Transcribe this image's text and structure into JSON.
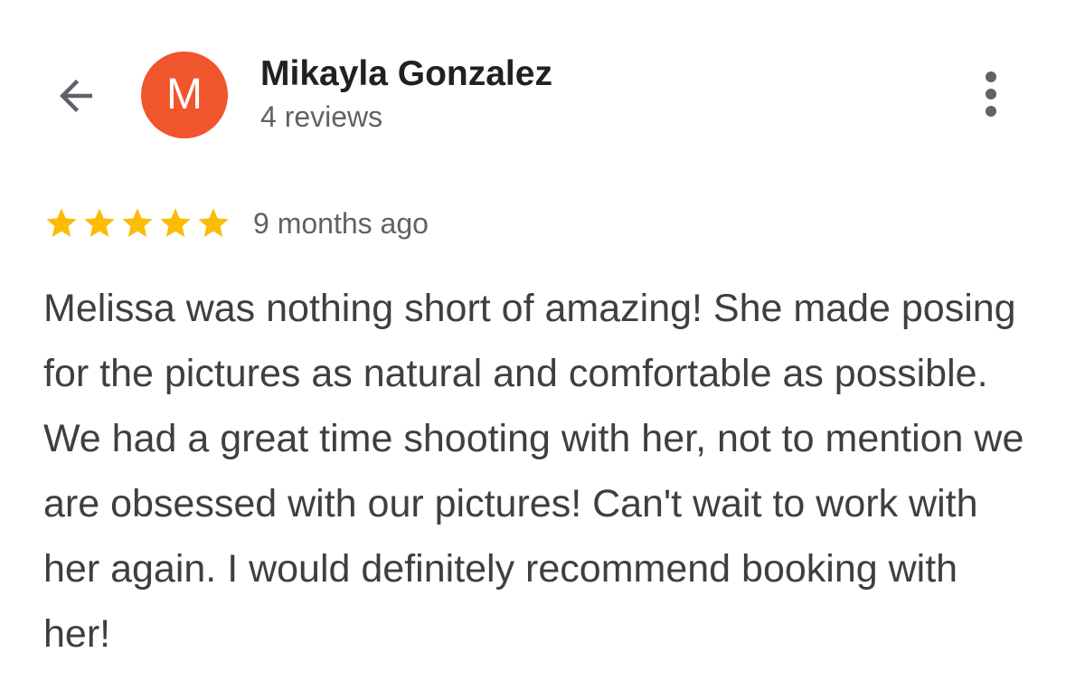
{
  "header": {
    "back_icon": "arrow-left-icon",
    "avatar_initial": "M",
    "avatar_color": "#f0552b",
    "reviewer_name": "Mikayla Gonzalez",
    "review_count": "4 reviews",
    "more_icon": "more-vert-icon"
  },
  "review": {
    "rating": 5,
    "max_rating": 5,
    "star_color": "#fbbc04",
    "time_ago": "9 months ago",
    "text": "Melissa was nothing short of amazing! She made posing for the pictures as natural and comfortable as possible. We had a great time shooting with her, not to mention we are obsessed with our pictures! Can't wait to work with her again. I would definitely recommend booking with her!"
  }
}
